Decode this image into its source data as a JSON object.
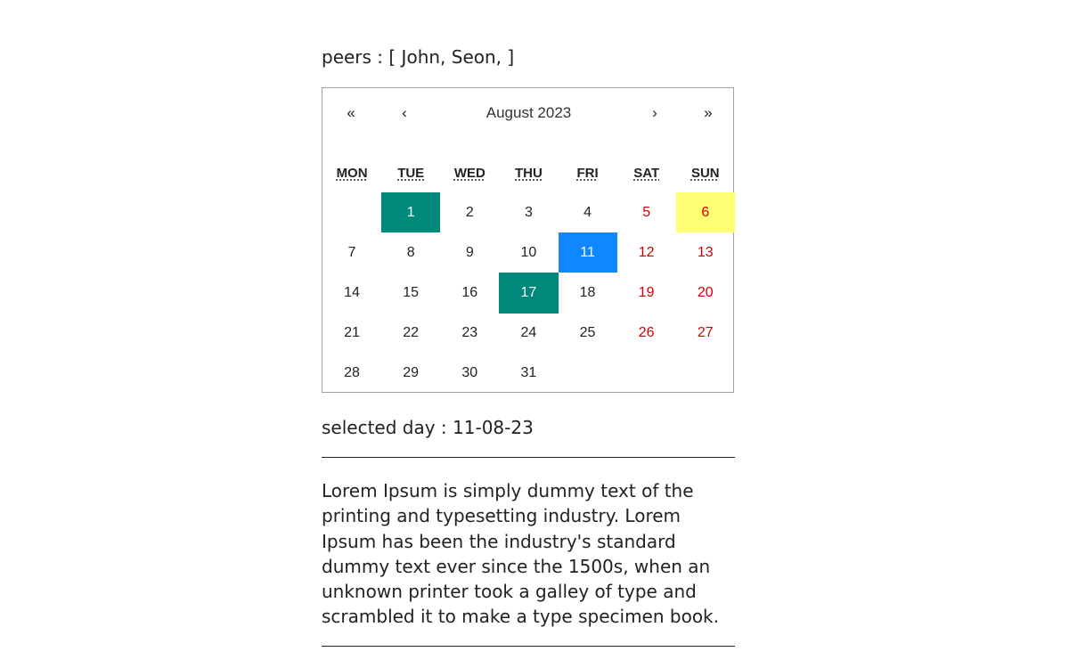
{
  "peers": {
    "text": "peers : [ John, Seon, ]"
  },
  "calendar": {
    "nav": {
      "prev_year": "«",
      "prev_month": "‹",
      "label": "August 2023",
      "next_month": "›",
      "next_year": "»"
    },
    "weekdays": [
      "MON",
      "TUE",
      "WED",
      "THU",
      "FRI",
      "SAT",
      "SUN"
    ],
    "weeks": [
      [
        "",
        "1",
        "2",
        "3",
        "4",
        "5",
        "6"
      ],
      [
        "7",
        "8",
        "9",
        "10",
        "11",
        "12",
        "13"
      ],
      [
        "14",
        "15",
        "16",
        "17",
        "18",
        "19",
        "20"
      ],
      [
        "21",
        "22",
        "23",
        "24",
        "25",
        "26",
        "27"
      ],
      [
        "28",
        "29",
        "30",
        "31",
        "",
        "",
        ""
      ]
    ],
    "highlighted_green": [
      "1",
      "17"
    ],
    "selected_day": "11",
    "today": "6",
    "colors": {
      "green": "#00897b",
      "blue": "#1087ff",
      "today": "#ffff76",
      "weekend": "#d10000"
    }
  },
  "selected": {
    "text": "selected day : 11-08-23"
  },
  "lorem": {
    "text": "Lorem Ipsum is simply dummy text of the printing and typesetting industry. Lorem Ipsum has been the industry's standard dummy text ever since the 1500s, when an unknown printer took a galley of type and scrambled it to make a type specimen book."
  }
}
